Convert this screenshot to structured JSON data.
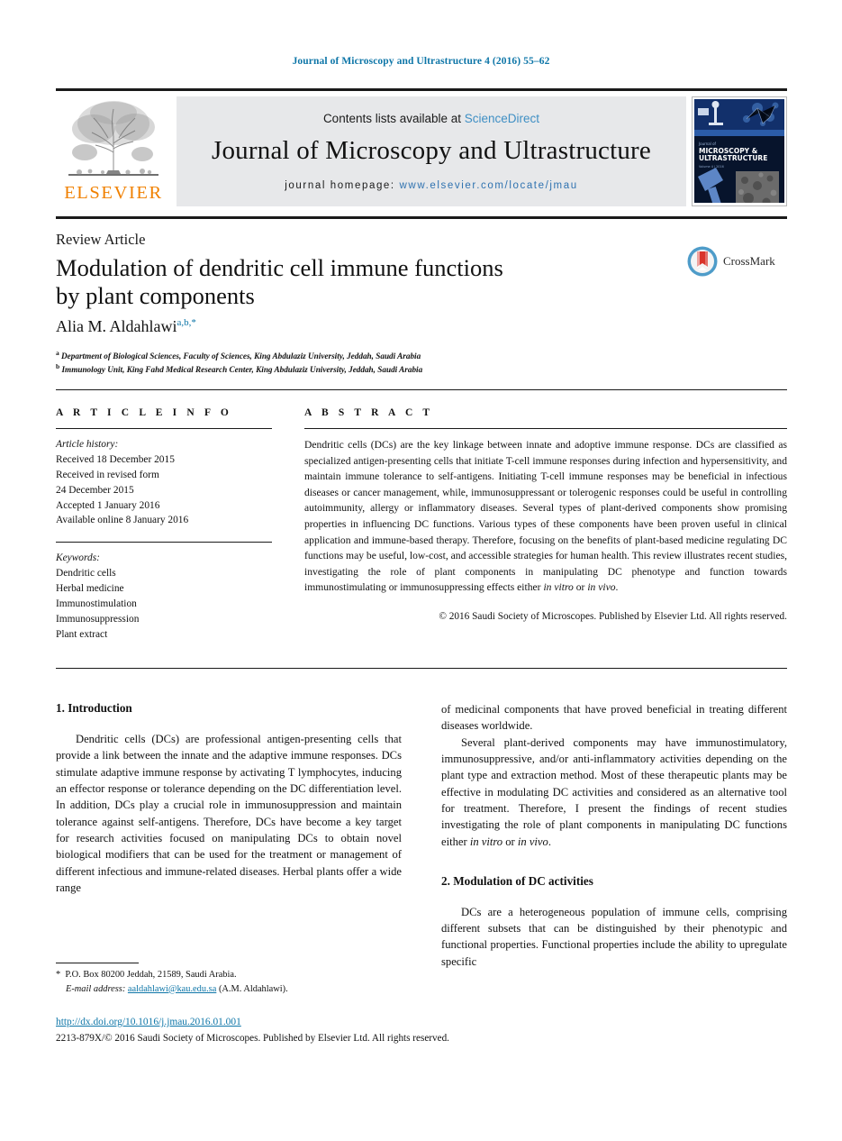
{
  "running_head": "Journal of Microscopy and Ultrastructure 4 (2016) 55–62",
  "masthead": {
    "publisher_wordmark": "ELSEVIER",
    "contents_prefix": "Contents lists available at ",
    "contents_link": "ScienceDirect",
    "journal_name": "Journal of Microscopy and Ultrastructure",
    "homepage_prefix": "journal homepage: ",
    "homepage_url": "www.elsevier.com/locate/jmau"
  },
  "title_block": {
    "article_type": "Review Article",
    "title_line1": "Modulation of dendritic cell immune functions",
    "title_line2": "by plant components",
    "author": "Alia M. Aldahlawi",
    "author_sup_a": "a",
    "author_sup_b": "b",
    "author_sup_star": "*",
    "affiliation_a_marker": "a",
    "affiliation_a": "Department of Biological Sciences, Faculty of Sciences, King Abdulaziz University, Jeddah, Saudi Arabia",
    "affiliation_b_marker": "b",
    "affiliation_b": "Immunology Unit, King Fahd Medical Research Center, King Abdulaziz University, Jeddah, Saudi Arabia",
    "crossmark_label": "CrossMark"
  },
  "article_info": {
    "heading": "A R T I C L E    I N F O",
    "history_label": "Article history:",
    "history": [
      "Received 18 December 2015",
      "Received in revised form",
      "24 December 2015",
      "Accepted 1 January 2016",
      "Available online 8 January 2016"
    ],
    "keywords_label": "Keywords:",
    "keywords": [
      "Dendritic cells",
      "Herbal medicine",
      "Immunostimulation",
      "Immunosuppression",
      "Plant extract"
    ]
  },
  "abstract": {
    "heading": "A B S T R A C T",
    "text_part1": "Dendritic cells (DCs) are the key linkage between innate and adoptive immune response. DCs are classified as specialized antigen-presenting cells that initiate T-cell immune responses during infection and hypersensitivity, and maintain immune tolerance to self-antigens. Initiating T-cell immune responses may be beneficial in infectious diseases or cancer management, while, immunosuppressant or tolerogenic responses could be useful in controlling autoimmunity, allergy or inflammatory diseases. Several types of plant-derived components show promising properties in influencing DC functions. Various types of these components have been proven useful in clinical application and immune-based therapy. Therefore, focusing on the benefits of plant-based medicine regulating DC functions may be useful, low-cost, and accessible strategies for human health. This review illustrates recent studies, investigating the role of plant components in manipulating DC phenotype and function towards immunostimulating or immunosuppressing effects either ",
    "italic1": "in vitro",
    "text_mid": " or ",
    "italic2": "in vivo",
    "text_end": ".",
    "copyright": "© 2016 Saudi Society of Microscopes. Published by Elsevier Ltd. All rights reserved."
  },
  "body": {
    "left": {
      "section1_heading": "1.  Introduction",
      "paragraph1": "Dendritic cells (DCs) are professional antigen-presenting cells that provide a link between the innate and the adaptive immune responses. DCs stimulate adaptive immune response by activating T lymphocytes, inducing an effector response or tolerance depending on the DC differentiation level. In addition, DCs play a crucial role in immunosuppression and maintain tolerance against self-antigens. Therefore, DCs have become a key target for research activities focused on manipulating DCs to obtain novel biological modifiers that can be used for the treatment or management of different infectious and immune-related diseases. Herbal plants offer a wide range"
    },
    "right": {
      "paragraph1_cont": "of medicinal components that have proved beneficial in treating different diseases worldwide.",
      "paragraph2_a": "Several plant-derived components may have immunostimulatory, immunosuppressive, and/or anti-inflammatory activities depending on the plant type and extraction method. Most of these therapeutic plants may be effective in modulating DC activities and considered as an alternative tool for treatment. Therefore, I present the findings of recent studies investigating the role of plant components in manipulating DC functions either ",
      "paragraph2_italic1": "in vitro",
      "paragraph2_mid": " or ",
      "paragraph2_italic2": "in vivo",
      "paragraph2_end": ".",
      "section2_heading": "2.  Modulation of DC activities",
      "paragraph3": "DCs are a heterogeneous population of immune cells, comprising different subsets that can be distinguished by their phenotypic and functional properties. Functional properties include the ability to upregulate specific"
    }
  },
  "footer": {
    "corresp_star": "*",
    "corresp_address": "P.O. Box 80200 Jeddah, 21589, Saudi Arabia.",
    "email_label": "E-mail address:",
    "email": "aaldahlawi@kau.edu.sa",
    "email_owner": "(A.M. Aldahlawi).",
    "doi": "http://dx.doi.org/10.1016/j.jmau.2016.01.001",
    "issn_line": "2213-879X/© 2016 Saudi Society of Microscopes. Published by Elsevier Ltd. All rights reserved."
  },
  "colors": {
    "link_blue": "#0e76a8",
    "elsevier_orange": "#f08000",
    "band_gray": "#e7e8ea",
    "crossmark_blue": "#4e9cc9",
    "crossmark_red": "#d9342b"
  }
}
